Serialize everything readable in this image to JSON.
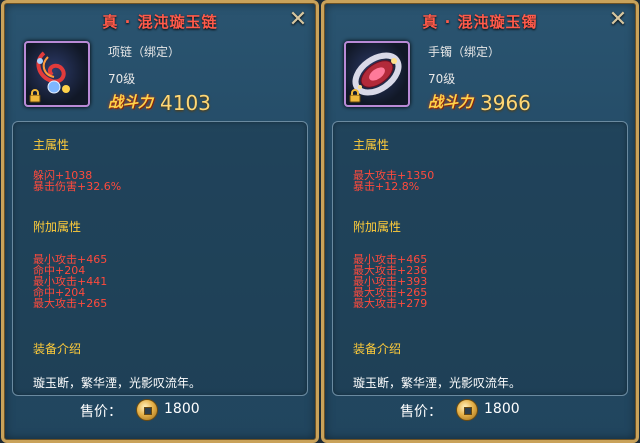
{
  "panels": [
    {
      "title": "真 · 混沌璇玉链",
      "close_icon": "close-icon",
      "item_icon": "necklace-icon",
      "item_type": "项链（绑定）",
      "level": "70级",
      "power_label": "战斗力",
      "power_value": "4103",
      "main_attr_title": "主属性",
      "main_attrs": [
        "躲闪+1038",
        "暴击伤害+32.6%"
      ],
      "extra_attr_title": "附加属性",
      "extra_attrs": [
        "最小攻击+465",
        "命中+204",
        "最小攻击+441",
        "命中+204",
        "最大攻击+265"
      ],
      "desc_title": "装备介绍",
      "desc": "璇玉断，繁华湮，光影叹流年。",
      "price_label": "售价：",
      "price_value": "1800"
    },
    {
      "title": "真 · 混沌璇玉镯",
      "close_icon": "close-icon",
      "item_icon": "bracelet-icon",
      "item_type": "手镯（绑定）",
      "level": "70级",
      "power_label": "战斗力",
      "power_value": "3966",
      "main_attr_title": "主属性",
      "main_attrs": [
        "最大攻击+1350",
        "暴击+12.8%"
      ],
      "extra_attr_title": "附加属性",
      "extra_attrs": [
        "最小攻击+465",
        "最大攻击+236",
        "最小攻击+393",
        "最大攻击+265",
        "最大攻击+279"
      ],
      "desc_title": "装备介绍",
      "desc": "璇玉断，繁华湮，光影叹流年。",
      "price_label": "售价：",
      "price_value": "1800"
    }
  ],
  "colors": {
    "title": "#ff5a4a",
    "section_head": "#ffcc3a",
    "stat": "#ff4a3c",
    "border": "#c9a25a"
  }
}
